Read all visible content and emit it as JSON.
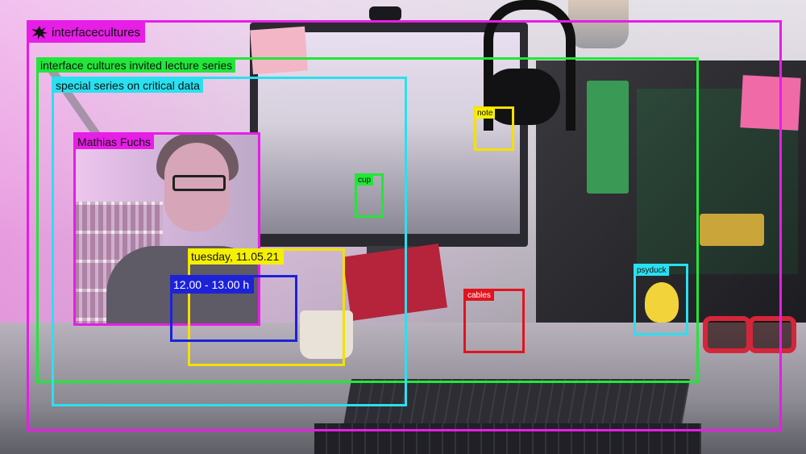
{
  "brand": {
    "label": "interfacecultures"
  },
  "annotations": {
    "lecture_series": "interface cultures invited lecture series",
    "special_series": "special series on critical data",
    "speaker": "Mathias Fuchs",
    "date": "tuesday, 11.05.21",
    "time": "12.00 - 13.00 h"
  },
  "objects": {
    "note": "note",
    "cup": "cup",
    "cables": "cables",
    "psyduck": "psyduck"
  },
  "colors": {
    "magenta": "#e61ee6",
    "green": "#22e63a",
    "cyan": "#2ae0f0",
    "yellow": "#f5f000",
    "blue": "#1c22d8",
    "red": "#e0141e"
  },
  "icons": {
    "logo": "splat-logo-icon"
  }
}
